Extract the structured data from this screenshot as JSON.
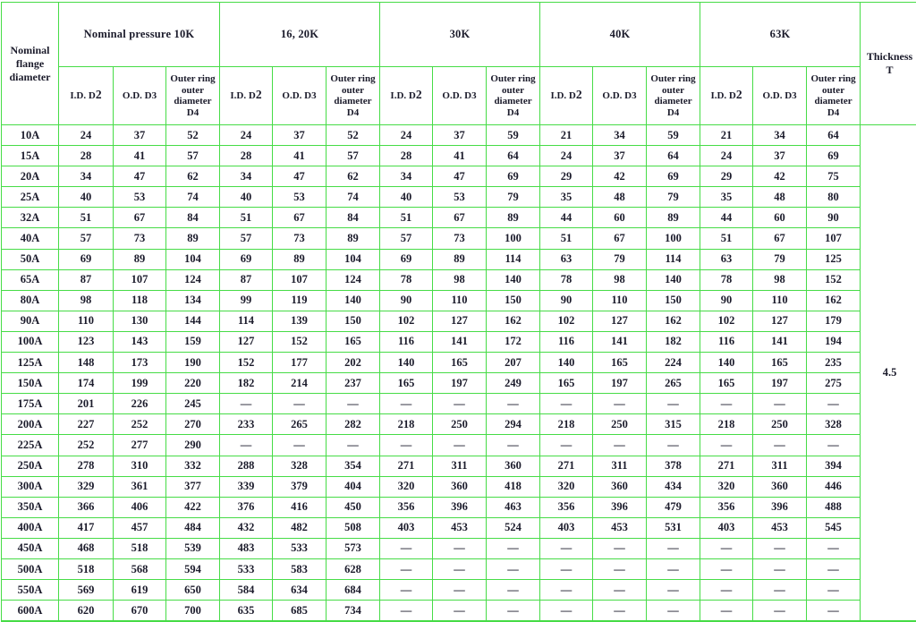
{
  "table": {
    "corner_header": "Nominal flange diameter",
    "thickness_header_line1": "Thickness",
    "thickness_header_line2": "T",
    "thickness_value": "4.5",
    "border_color": "#46dc46",
    "rule_color": "#262626",
    "text_color": "#1b1b2b",
    "groups": [
      {
        "label": "Nominal pressure 10K"
      },
      {
        "label": "16, 20K"
      },
      {
        "label": "30K"
      },
      {
        "label": "40K"
      },
      {
        "label": "63K"
      }
    ],
    "sub_headers": [
      {
        "id": "id_d2",
        "text": "I.D. D",
        "sub": "2"
      },
      {
        "id": "od_d3",
        "text": "O.D. D3",
        "sub": ""
      },
      {
        "id": "outer_ring_d4",
        "text": "Outer ring outer diameter D4",
        "sub": ""
      }
    ],
    "sub_headers_flat": [
      "I.D. D 2",
      "O.D. D3",
      "Outer ring outer diameter D4",
      "I.D. D 2",
      "O.D. D3",
      "Outer ring outer diameter D4",
      "I.D. D 2",
      "O.D. D3",
      "Outer ring outer diameter D4",
      "I.D. D 2",
      "O.D. D3",
      "Outer ring outer diameter D4",
      "I.D. D 2",
      "O.D. D3",
      "Outer ring outer diameter D4"
    ],
    "rows": [
      {
        "name": "10A",
        "values": [
          "24",
          "37",
          "52",
          "24",
          "37",
          "52",
          "24",
          "37",
          "59",
          "21",
          "34",
          "59",
          "21",
          "34",
          "64"
        ]
      },
      {
        "name": "15A",
        "values": [
          "28",
          "41",
          "57",
          "28",
          "41",
          "57",
          "28",
          "41",
          "64",
          "24",
          "37",
          "64",
          "24",
          "37",
          "69"
        ]
      },
      {
        "name": "20A",
        "values": [
          "34",
          "47",
          "62",
          "34",
          "47",
          "62",
          "34",
          "47",
          "69",
          "29",
          "42",
          "69",
          "29",
          "42",
          "75"
        ]
      },
      {
        "name": "25A",
        "values": [
          "40",
          "53",
          "74",
          "40",
          "53",
          "74",
          "40",
          "53",
          "79",
          "35",
          "48",
          "79",
          "35",
          "48",
          "80"
        ]
      },
      {
        "name": "32A",
        "values": [
          "51",
          "67",
          "84",
          "51",
          "67",
          "84",
          "51",
          "67",
          "89",
          "44",
          "60",
          "89",
          "44",
          "60",
          "90"
        ]
      },
      {
        "name": "40A",
        "values": [
          "57",
          "73",
          "89",
          "57",
          "73",
          "89",
          "57",
          "73",
          "100",
          "51",
          "67",
          "100",
          "51",
          "67",
          "107"
        ]
      },
      {
        "name": "50A",
        "values": [
          "69",
          "89",
          "104",
          "69",
          "89",
          "104",
          "69",
          "89",
          "114",
          "63",
          "79",
          "114",
          "63",
          "79",
          "125"
        ]
      },
      {
        "name": "65A",
        "values": [
          "87",
          "107",
          "124",
          "87",
          "107",
          "124",
          "78",
          "98",
          "140",
          "78",
          "98",
          "140",
          "78",
          "98",
          "152"
        ]
      },
      {
        "name": "80A",
        "values": [
          "98",
          "118",
          "134",
          "99",
          "119",
          "140",
          "90",
          "110",
          "150",
          "90",
          "110",
          "150",
          "90",
          "110",
          "162"
        ]
      },
      {
        "name": "90A",
        "values": [
          "110",
          "130",
          "144",
          "114",
          "139",
          "150",
          "102",
          "127",
          "162",
          "102",
          "127",
          "162",
          "102",
          "127",
          "179"
        ]
      },
      {
        "name": "100A",
        "values": [
          "123",
          "143",
          "159",
          "127",
          "152",
          "165",
          "116",
          "141",
          "172",
          "116",
          "141",
          "182",
          "116",
          "141",
          "194"
        ]
      },
      {
        "name": "125A",
        "values": [
          "148",
          "173",
          "190",
          "152",
          "177",
          "202",
          "140",
          "165",
          "207",
          "140",
          "165",
          "224",
          "140",
          "165",
          "235"
        ]
      },
      {
        "name": "150A",
        "values": [
          "174",
          "199",
          "220",
          "182",
          "214",
          "237",
          "165",
          "197",
          "249",
          "165",
          "197",
          "265",
          "165",
          "197",
          "275"
        ]
      },
      {
        "name": "175A",
        "values": [
          "201",
          "226",
          "245",
          "—",
          "—",
          "—",
          "—",
          "—",
          "—",
          "—",
          "—",
          "—",
          "—",
          "—",
          "—"
        ]
      },
      {
        "name": "200A",
        "values": [
          "227",
          "252",
          "270",
          "233",
          "265",
          "282",
          "218",
          "250",
          "294",
          "218",
          "250",
          "315",
          "218",
          "250",
          "328"
        ]
      },
      {
        "name": "225A",
        "values": [
          "252",
          "277",
          "290",
          "—",
          "—",
          "—",
          "—",
          "—",
          "—",
          "—",
          "—",
          "—",
          "—",
          "—",
          "—"
        ]
      },
      {
        "name": "250A",
        "values": [
          "278",
          "310",
          "332",
          "288",
          "328",
          "354",
          "271",
          "311",
          "360",
          "271",
          "311",
          "378",
          "271",
          "311",
          "394"
        ]
      },
      {
        "name": "300A",
        "values": [
          "329",
          "361",
          "377",
          "339",
          "379",
          "404",
          "320",
          "360",
          "418",
          "320",
          "360",
          "434",
          "320",
          "360",
          "446"
        ]
      },
      {
        "name": "350A",
        "values": [
          "366",
          "406",
          "422",
          "376",
          "416",
          "450",
          "356",
          "396",
          "463",
          "356",
          "396",
          "479",
          "356",
          "396",
          "488"
        ]
      },
      {
        "name": "400A",
        "values": [
          "417",
          "457",
          "484",
          "432",
          "482",
          "508",
          "403",
          "453",
          "524",
          "403",
          "453",
          "531",
          "403",
          "453",
          "545"
        ]
      },
      {
        "name": "450A",
        "values": [
          "468",
          "518",
          "539",
          "483",
          "533",
          "573",
          "—",
          "—",
          "—",
          "—",
          "—",
          "—",
          "—",
          "—",
          "—"
        ]
      },
      {
        "name": "500A",
        "values": [
          "518",
          "568",
          "594",
          "533",
          "583",
          "628",
          "—",
          "—",
          "—",
          "—",
          "—",
          "—",
          "—",
          "—",
          "—"
        ]
      },
      {
        "name": "550A",
        "values": [
          "569",
          "619",
          "650",
          "584",
          "634",
          "684",
          "—",
          "—",
          "—",
          "—",
          "—",
          "—",
          "—",
          "—",
          "—"
        ]
      },
      {
        "name": "600A",
        "values": [
          "620",
          "670",
          "700",
          "635",
          "685",
          "734",
          "—",
          "—",
          "—",
          "—",
          "—",
          "—",
          "—",
          "—",
          "—"
        ]
      }
    ]
  }
}
